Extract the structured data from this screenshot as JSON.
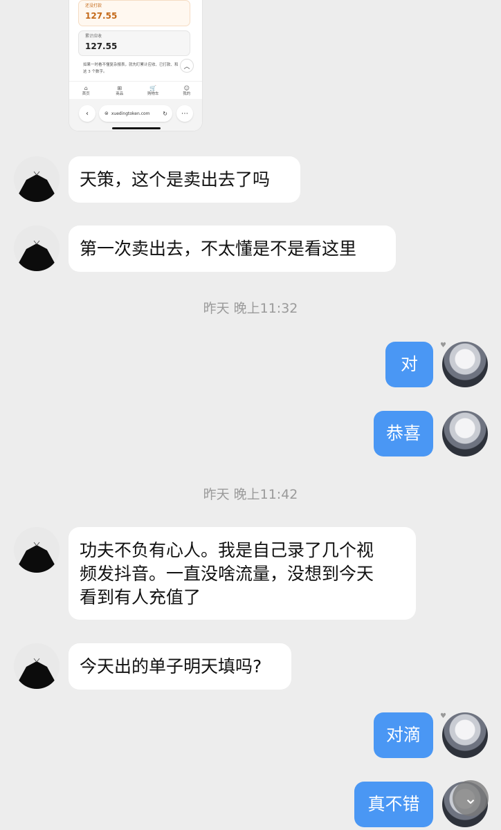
{
  "screenshot": {
    "card1": {
      "label": "还没打款",
      "value": "127.55"
    },
    "card2": {
      "label": "累计应收",
      "value": "127.55"
    },
    "note_line1": "如果一时看不懂复杂报表，就先盯累计应收、已打款、和",
    "note_line2": "这 3 个数字。",
    "nav": [
      {
        "icon": "⌂",
        "label": "首页"
      },
      {
        "icon": "⊞",
        "label": "商品"
      },
      {
        "icon": "🛒",
        "label": "购物车"
      },
      {
        "icon": "☺",
        "label": "我的"
      }
    ],
    "url": "xuedingtoken.com"
  },
  "messages": {
    "m1": "天策，这个是卖出去了吗",
    "m2": "第一次卖出去，不太懂是不是看这里",
    "ts1": "昨天 晚上11:32",
    "r1": "对",
    "r2": "恭喜",
    "ts2": "昨天 晚上11:42",
    "m3": "功夫不负有心人。我是自己录了几个视\n频发抖音。一直没啥流量，没想到今天\n看到有人充值了",
    "m4": "今天出的单子明天填吗?",
    "r3": "对滴",
    "r4": "真不错"
  },
  "colors": {
    "background": "#ededed",
    "sent_bubble": "#4a97f4",
    "received_bubble": "#ffffff"
  }
}
